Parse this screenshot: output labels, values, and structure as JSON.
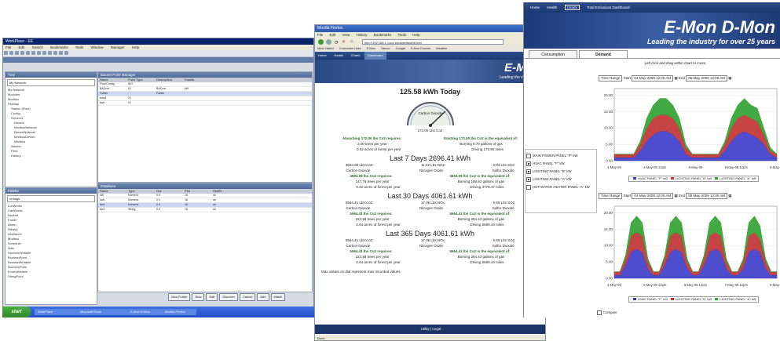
{
  "workplace": {
    "title": "WorkPlace - EE",
    "menu": [
      "File",
      "Edit",
      "Search",
      "Bookmarks",
      "Tools",
      "Window",
      "Manager",
      "Help"
    ],
    "tree_header": "Tree",
    "tree_filter": "My Network",
    "tree_items": [
      "My Network",
      "Modules",
      "Modbus",
      "FileMap",
      "Station (Root)",
      "Config",
      "Services",
      "Drivers",
      "ModbusNetwork",
      "BacnetNetwork",
      "ModbusDevice",
      "Modbus",
      "Alarms",
      "Files",
      "History"
    ],
    "palette_header": "Palette",
    "palette_filter": "emtags",
    "palette_items": [
      "LonWorks",
      "CanWorks",
      "BacNet",
      "Folder",
      "Alarm",
      "History",
      "Interfaces",
      "Modbus",
      "Schedule",
      "Ndio",
      "NumericWritable",
      "BooleanPoint",
      "BooleanWritable",
      "NumericPoint",
      "EnumWritable",
      "StringPoint"
    ],
    "main_header": "Bacnet Point Manager",
    "top_table_header": [
      "Name",
      "Point Type",
      "Description",
      "Facets"
    ],
    "top_table_rows": [
      [
        "PointConfig",
        "AIO",
        "",
        ""
      ],
      [
        "BACnet",
        "IO",
        "BACnet",
        "kW"
      ],
      [
        "Folder",
        "",
        "Folder",
        ""
      ],
      [
        "trend",
        "IO",
        "",
        ""
      ],
      [
        "kwh",
        "IO",
        "",
        ""
      ]
    ],
    "bottom_header": "Database",
    "bottom_table_header": [
      "Name",
      "Type",
      "Out",
      "Prio",
      "Health"
    ],
    "bottom_table_rows": [
      [
        "kW",
        "Numeric",
        "0.0",
        "16",
        "ok"
      ],
      [
        "kwh",
        "Numeric",
        "0.0",
        "16",
        "ok"
      ],
      [
        "kw2",
        "Numeric",
        "0.0",
        "16",
        "ok"
      ],
      [
        "kw3",
        "String",
        "0.0",
        "16",
        "ok"
      ]
    ],
    "buttons": [
      "New Folder",
      "New",
      "Edit",
      "Discover",
      "Cancel",
      "Add",
      "Match"
    ],
    "taskbar": {
      "start": "start",
      "tasks": [
        "WorkPlace",
        "Microsoft Excel",
        "E-Mon D-Mon",
        "Mozilla Firefox"
      ]
    }
  },
  "firefox": {
    "title": "Mozilla Firefox",
    "menu": [
      "File",
      "Edit",
      "View",
      "History",
      "Bookmarks",
      "Tools",
      "Help"
    ],
    "url": "http://192.168.1.1/cgi-bin/dashboard.html",
    "bookmarks": [
      "Most Visited",
      "Customize Links",
      "E-Mon",
      "Yahoo!",
      "Google",
      "E-Mon Forums",
      "Weather"
    ],
    "tabs": [
      "Home",
      "Health",
      "Charts",
      "Dashboard"
    ],
    "brand": "E-Mon",
    "tagline": "Leading the industry for",
    "today_title": "125.58 kWh Today",
    "gauge_label": "Carbon Dioxide",
    "gauge_value": "172.00 Lbs Co2",
    "stmt_left": "Absorbing 172.00 lbs Co2 requires:",
    "stmt_right": "Emitting 172.00 lbs Co2 is the equivalent of:",
    "left_a": "2.00 trees per year",
    "left_b": "0.02 acres of forest per year",
    "right_a": "Burning 8.78 gallons of gas",
    "right_b": "Driving 175.90 miles",
    "sections": [
      {
        "title": "Last 7 Days 2696.41 kWh",
        "co2": "3694.08 Lbs Co2",
        "nox": "11.02 Lbs NOx",
        "sox": "0.84 Lbs SO2",
        "trees": "147.76 trees per year",
        "acres": "0.42 acres of forest per year",
        "gas": "Burning 188.62 gallons of gas",
        "miles": "Driving 3778.47 miles",
        "absorb": "3694.08 lbs Co2 requires:",
        "emit": "3694.08 lbs Co2 is the equivalent of:"
      },
      {
        "title": "Last 30 Days 4061.61 kWh",
        "co2": "5564.41 Lbs Co2",
        "nox": "17.06 Lbs NOx",
        "sox": "0.65 Lbs SO2",
        "trees": "222.58 trees per year",
        "acres": "0.64 acres of forest per year",
        "gas": "Burning 284.42 gallons of gas",
        "miles": "Driving 5689.44 miles",
        "absorb": "5564.41 lbs Co2 requires:",
        "emit": "5564.41 lbs Co2 is the equivalent of:"
      },
      {
        "title": "Last 365 Days 4061.61 kWh",
        "co2": "5564.41 Lbs Co2",
        "nox": "17.06 Lbs NOx",
        "sox": "0.65 Lbs SO2",
        "trees": "222.58 trees per year",
        "acres": "0.64 acres of forest per year",
        "gas": "Burning 284.42 gallons of gas",
        "miles": "Driving 5689.44 miles",
        "absorb": "5564.41 lbs Co2 requires:",
        "emit": "5564.41 lbs Co2 is the equivalent of:"
      }
    ],
    "labels": {
      "co2": "Carbon Dioxide",
      "nox": "Nitrogen Oxide",
      "sox": "Sulfur Dioxide"
    },
    "footnote": "Max values on dial represent max recorded values.",
    "bottom_links": "Utility | Legal",
    "status": "Done"
  },
  "dashboard": {
    "nav": [
      "Home",
      "Health",
      "Charts",
      "Total Emissions Dashboard"
    ],
    "brand": "E-Mon D-Mon",
    "tagline": "Leading the industry for over 25 years",
    "tabs": [
      "Consumption",
      "Demand"
    ],
    "hint": "Left click and drag within chart to zoom.",
    "time_range": "Time Range",
    "start_label": "Start",
    "end_label": "End",
    "start1": "04-May-2009 12:00 AM",
    "end1": "06-May-2009 12:00 AM",
    "start2": "04-May-2009 12:00 AM",
    "end2": "08-May-2009 12:00 AM",
    "checkboxes": [
      {
        "label": "MAIN POWER PANEL \"P\" kW",
        "checked": false
      },
      {
        "label": "HVAC PANEL \"F\" kW",
        "checked": true
      },
      {
        "label": "LIGHTING PANEL \"B\" kW",
        "checked": true
      },
      {
        "label": "LIGHTING PANEL \"A\" kW",
        "checked": true
      },
      {
        "label": "HOT WATER HEATER PANEL \"A\" kW",
        "checked": false
      }
    ],
    "compare": "Compare",
    "colors": {
      "hvac": "#3a3ac8",
      "lightB": "#c03030",
      "lightA": "#2fa02f"
    }
  },
  "chart_data": [
    {
      "type": "area",
      "yticks": [
        "20.00",
        "15.00",
        "10.00",
        "5.00",
        "0.00"
      ],
      "ylim": [
        0,
        22
      ],
      "categories": [
        "4-May-09",
        "4-May-09 12pm",
        "5-May-09",
        "5-May-09 12pm",
        "6-May-09"
      ],
      "series": [
        {
          "name": "HVAC PANEL \"F\" kW",
          "values": [
            1,
            1,
            1,
            1,
            3,
            6,
            8,
            9,
            9,
            8,
            6,
            2,
            1,
            1,
            1,
            1,
            1,
            3,
            6,
            8,
            9,
            8,
            7,
            5,
            2,
            1
          ]
        },
        {
          "name": "LIGHTING PANEL \"B\" kW",
          "values": [
            1,
            1,
            1,
            1,
            2,
            4,
            5,
            5,
            5,
            5,
            4,
            2,
            1,
            1,
            1,
            1,
            1,
            2,
            4,
            5,
            5,
            5,
            5,
            3,
            1,
            1
          ]
        },
        {
          "name": "LIGHTING PANEL \"A\" kW",
          "values": [
            0,
            0,
            0,
            0,
            1,
            3,
            4,
            5,
            5,
            4,
            3,
            1,
            0,
            0,
            0,
            0,
            0,
            1,
            3,
            4,
            5,
            4,
            4,
            2,
            1,
            0
          ]
        }
      ],
      "legend": [
        "HVAC PANEL \"F\" kW",
        "LIGHTING PANEL \"B\" kW",
        "LIGHTING PANEL \"A\" kW"
      ]
    },
    {
      "type": "area",
      "yticks": [
        "20.00",
        "15.00",
        "10.00",
        "5.00",
        "0.00"
      ],
      "ylim": [
        0,
        22
      ],
      "categories": [
        "4-May-09",
        "5-May-09 12pm",
        "6-May-09 12pm",
        "7-May-09 12pm",
        "8-May-09"
      ],
      "series": [
        {
          "name": "HVAC PANEL \"F\" kW",
          "values": [
            1,
            1,
            4,
            8,
            9,
            8,
            3,
            1,
            1,
            4,
            8,
            9,
            8,
            3,
            1,
            1,
            4,
            8,
            9,
            8,
            3,
            1,
            1,
            3,
            8,
            9,
            8,
            3,
            1,
            1
          ]
        },
        {
          "name": "LIGHTING PANEL \"B\" kW",
          "values": [
            1,
            1,
            2,
            5,
            5,
            5,
            2,
            1,
            1,
            2,
            5,
            5,
            5,
            2,
            1,
            1,
            2,
            5,
            5,
            5,
            2,
            1,
            1,
            2,
            5,
            5,
            4,
            2,
            1,
            1
          ]
        },
        {
          "name": "LIGHTING PANEL \"A\" kW",
          "values": [
            0,
            0,
            1,
            4,
            5,
            4,
            1,
            0,
            0,
            1,
            4,
            5,
            4,
            1,
            0,
            0,
            1,
            4,
            5,
            4,
            1,
            0,
            0,
            1,
            4,
            5,
            4,
            1,
            0,
            0
          ]
        }
      ],
      "legend": [
        "HVAC PANEL \"F\" kW",
        "LIGHTING PANEL \"B\" kW",
        "LIGHTING PANEL \"A\" kW"
      ]
    }
  ]
}
